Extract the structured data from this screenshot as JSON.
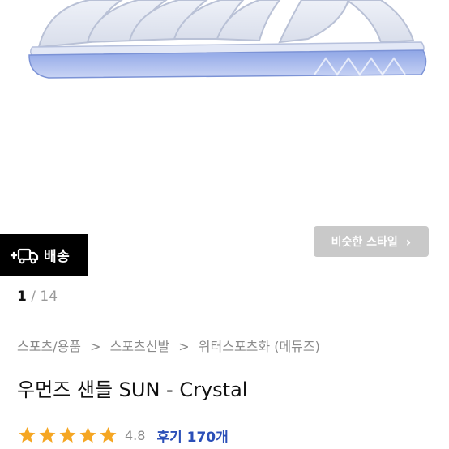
{
  "hero": {
    "image_name": "clear-jelly-sandal"
  },
  "delivery_badge": {
    "label": "배송",
    "icon": "fast-delivery-truck-icon"
  },
  "similar_style": {
    "label": "비슷한 스타일",
    "icon": "chevron-right-icon"
  },
  "pager": {
    "current": "1",
    "separator": "/",
    "total": "14"
  },
  "breadcrumb": {
    "items": [
      "스포츠/용품",
      "스포츠신발",
      "워터스포츠화 (메듀즈)"
    ],
    "separator": ">"
  },
  "product": {
    "title": "우먼즈 샌들 SUN - Crystal"
  },
  "rating": {
    "stars": 5,
    "score": "4.8",
    "reviews_label": "후기 170개",
    "star_color": "#f5a623"
  },
  "colors": {
    "badge_bg": "#000000",
    "button_bg": "#c9c9c9",
    "link": "#2b4fb8"
  }
}
